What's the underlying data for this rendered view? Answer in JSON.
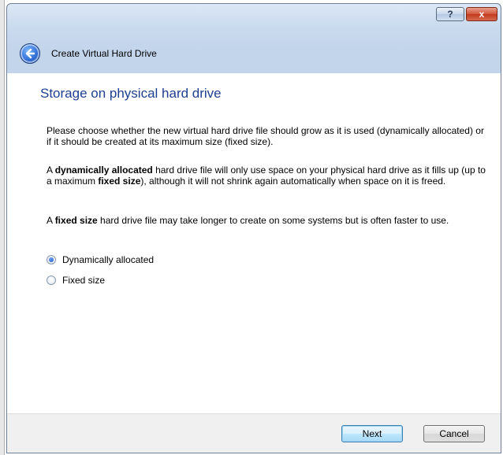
{
  "window": {
    "title": "Create Virtual Hard Drive",
    "help_label": "?",
    "close_label": "x"
  },
  "page": {
    "title": "Storage on physical hard drive",
    "intro": "Please choose whether the new virtual hard drive file should grow as it is used (dynamically allocated) or if it should be created at its maximum size (fixed size).",
    "dynamic_para": {
      "pre": "A ",
      "bold1": "dynamically allocated",
      "mid": " hard drive file will only use space on your physical hard drive as it fills up (up to a maximum ",
      "bold2": "fixed size",
      "post": "), although it will not shrink again automatically when space on it is freed."
    },
    "fixed_para": {
      "pre": "A ",
      "bold1": "fixed size",
      "post": " hard drive file may take longer to create on some systems but is often faster to use."
    }
  },
  "options": [
    {
      "label": "Dynamically allocated",
      "selected": true
    },
    {
      "label": "Fixed size",
      "selected": false
    }
  ],
  "footer": {
    "next_label": "Next",
    "cancel_label": "Cancel"
  },
  "icons": {
    "back": "back-arrow-icon"
  }
}
